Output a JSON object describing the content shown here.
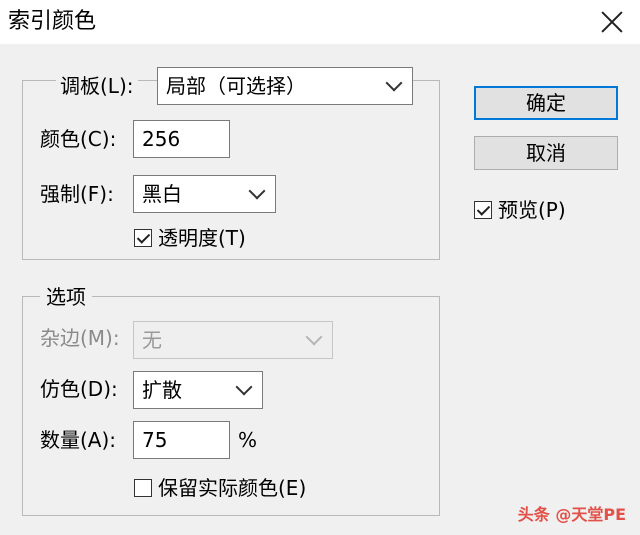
{
  "window": {
    "title": "索引颜色"
  },
  "palette_group": {
    "palette_label": "调板(L):",
    "palette_value": "局部（可选择）",
    "colors_label": "颜色(C):",
    "colors_value": "256",
    "forced_label": "强制(F):",
    "forced_value": "黑白",
    "transparency_label": "透明度(T)",
    "transparency_checked": true
  },
  "options_group": {
    "title": "选项",
    "matte_label": "杂边(M):",
    "matte_value": "无",
    "dither_label": "仿色(D):",
    "dither_value": "扩散",
    "amount_label": "数量(A):",
    "amount_value": "75",
    "amount_unit": "%",
    "preserve_label": "保留实际颜色(E)",
    "preserve_checked": false
  },
  "buttons": {
    "ok": "确定",
    "cancel": "取消"
  },
  "preview": {
    "label": "预览(P)",
    "checked": true
  },
  "watermark": {
    "text": "头条 @天堂PE"
  }
}
